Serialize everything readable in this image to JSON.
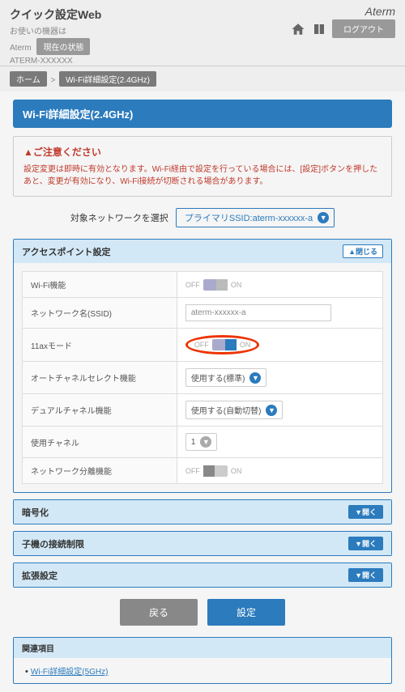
{
  "header": {
    "title": "クイック設定Web",
    "sub1": "お使いの機器は",
    "sub2": "Aterm",
    "model": "ATERM-XXXXXX",
    "status_btn": "現在の状態",
    "brand": "Aterm",
    "logout": "ログアウト"
  },
  "breadcrumb": {
    "home": "ホーム",
    "sep": ">",
    "current": "Wi-Fi詳細設定(2.4GHz)"
  },
  "page_title": "Wi-Fi詳細設定(2.4GHz)",
  "notice": {
    "title": "▲ご注意ください",
    "body": "設定変更は即時に有効となります。Wi-Fi経由で設定を行っている場合には、[設定]ボタンを押したあと、変更が有効になり、Wi-Fi接続が切断される場合があります。"
  },
  "netsel": {
    "label": "対象ネットワークを選択",
    "value": "プライマリSSID:aterm-xxxxxx-a"
  },
  "ap": {
    "title": "アクセスポイント設定",
    "collapse": "▲閉じる",
    "rows": [
      {
        "label": "Wi-Fi機能",
        "off": "OFF",
        "on": "ON"
      },
      {
        "label": "ネットワーク名(SSID)",
        "value": "aterm-xxxxxx-a"
      },
      {
        "label": "11axモード",
        "off": "OFF",
        "on": "ON"
      },
      {
        "label": "オートチャネルセレクト機能",
        "value": "使用する(標準)"
      },
      {
        "label": "デュアルチャネル機能",
        "value": "使用する(自動切替)"
      },
      {
        "label": "使用チャネル",
        "value": "1"
      },
      {
        "label": "ネットワーク分離機能",
        "off": "OFF",
        "on": "ON"
      }
    ]
  },
  "panels": [
    {
      "title": "暗号化",
      "expand": "▼開く"
    },
    {
      "title": "子機の接続制限",
      "expand": "▼開く"
    },
    {
      "title": "拡張設定",
      "expand": "▼開く"
    }
  ],
  "buttons": {
    "back": "戻る",
    "save": "設定"
  },
  "related": {
    "title": "関連項目",
    "link": "Wi-Fi詳細設定(5GHz)"
  }
}
